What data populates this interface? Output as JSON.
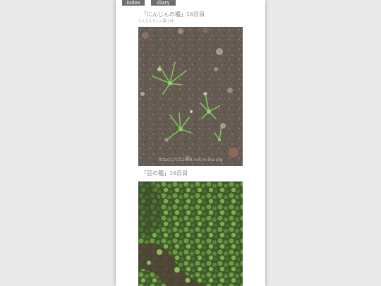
{
  "nav": {
    "index_label": "index",
    "diary_index_label": "diary index"
  },
  "entries": [
    {
      "caption": "「にんじんの種」16日目",
      "subcaption": "にんじんらしい葉っぱ",
      "watermark": "https://7512964.net.m-ina.org",
      "image_subject": "carrot-seedlings-in-soil"
    },
    {
      "caption": "「豆の種」16日目",
      "image_subject": "bean-sprouts-foliage"
    }
  ]
}
